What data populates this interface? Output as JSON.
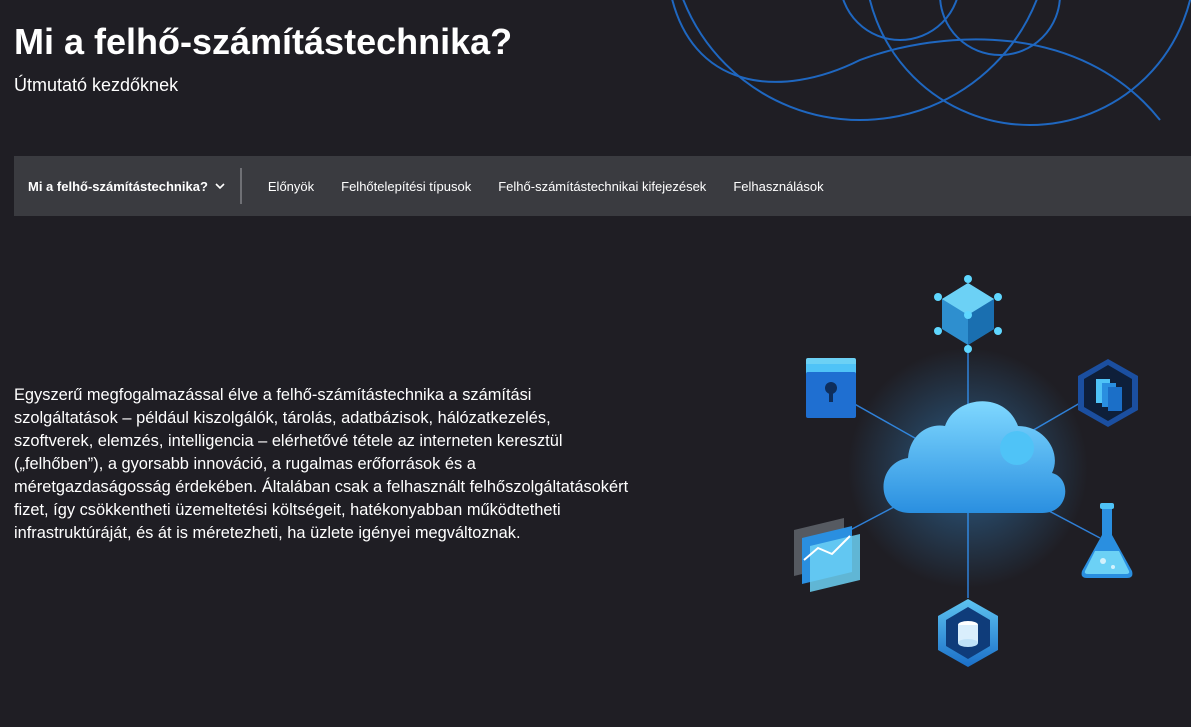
{
  "hero": {
    "title": "Mi a felhő-számítástechnika?",
    "subtitle": "Útmutató kezdőknek"
  },
  "nav": {
    "current": "Mi a felhő-számítástechnika?",
    "links": [
      "Előnyök",
      "Felhőtelepítési típusok",
      "Felhő-számítástechnikai kifejezések",
      "Felhasználások"
    ]
  },
  "main": {
    "paragraph": "Egyszerű megfogalmazással élve a felhő-számítástechnika a számítási szolgáltatások – például kiszolgálók, tárolás, adatbázisok, hálózatkezelés, szoftverek, elemzés, intelligencia – elérhetővé tétele az interneten keresztül („felhőben”), a gyorsabb innováció, a rugalmas erőforrások és a méretgazdaságosság érdekében. Általában csak a felhasznált felhőszolgáltatásokért fizet, így csökkentheti üzemeltetési költségeit, hatékonyabban működtetheti infrastruktúráját, és át is méretezheti, ha üzlete igényei megváltoznak."
  },
  "icons": {
    "hero_decoration": "blue-circles-decoration",
    "illustration": "cloud-services-illustration",
    "center": "cloud-icon",
    "satellites": [
      "cube-network-icon",
      "document-stack-icon",
      "flask-icon",
      "database-icon",
      "analytics-icon",
      "secure-folder-icon"
    ]
  },
  "colors": {
    "background": "#1f1e24",
    "nav_background": "#3a3b40",
    "accent": "#1e90e8",
    "cloud": "#4fc3f7"
  }
}
